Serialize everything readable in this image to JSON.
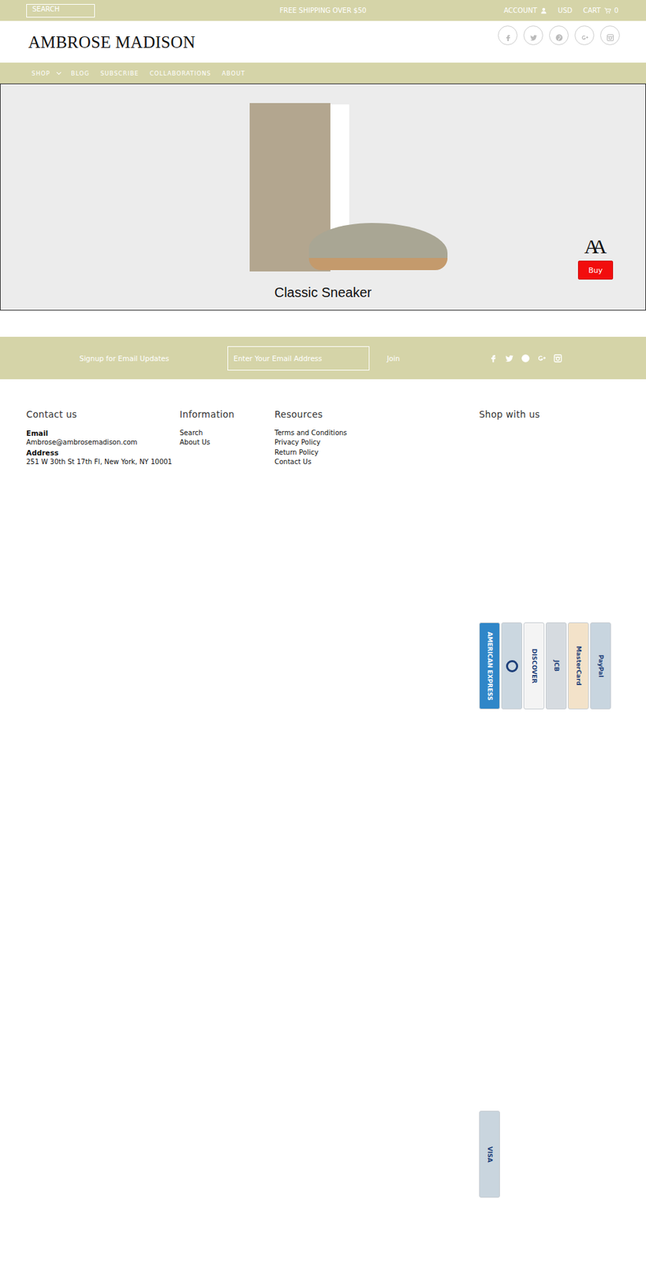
{
  "top_bar": {
    "search_placeholder": "SEARCH",
    "promo": "FREE SHIPPING OVER $50",
    "account": "ACCOUNT",
    "currency": "USD",
    "cart": "CART",
    "cart_count": "0"
  },
  "logo": "AMBROSE MADISON",
  "nav": [
    {
      "label": "SHOP",
      "dropdown": true
    },
    {
      "label": "BLOG",
      "dropdown": false
    },
    {
      "label": "SUBSCRIBE",
      "dropdown": false
    },
    {
      "label": "COLLABORATIONS",
      "dropdown": false
    },
    {
      "label": "ABOUT",
      "dropdown": false
    }
  ],
  "hero": {
    "title": "Classic Sneaker",
    "mark": "AA",
    "button": "Buy"
  },
  "signup": {
    "label": "Signup for Email Updates",
    "placeholder": "Enter Your Email Address",
    "button": "Join"
  },
  "footer": {
    "contact": {
      "title": "Contact us",
      "email_label": "Email",
      "email": "Ambrose@ambrosemadison.com",
      "address_label": "Address",
      "address": "251 W 30th St 17th Fl, New York, NY 10001"
    },
    "information": {
      "title": "Information",
      "links": [
        "Search",
        "About Us"
      ]
    },
    "resources": {
      "title": "Resources",
      "links": [
        "Terms and Conditions",
        "Privacy Policy",
        "Return Policy",
        "Contact Us"
      ]
    },
    "shop": {
      "title": "Shop with us",
      "cards": [
        {
          "kind": "text",
          "label": "AMERICAN EXPRESS",
          "color": "#2f86c8"
        },
        {
          "kind": "circle",
          "label": "",
          "color": "#cbd7e0"
        },
        {
          "kind": "text",
          "label": "DISCOVER",
          "color": "#f4f4f4"
        },
        {
          "kind": "text",
          "label": "JCB",
          "color": "#d6dbe0"
        },
        {
          "kind": "text",
          "label": "MasterCard",
          "color": "#f3e2c9"
        },
        {
          "kind": "text",
          "label": "PayPal",
          "color": "#c8d5df"
        },
        {
          "kind": "text",
          "label": "VISA",
          "color": "#c9d5de"
        }
      ]
    }
  }
}
